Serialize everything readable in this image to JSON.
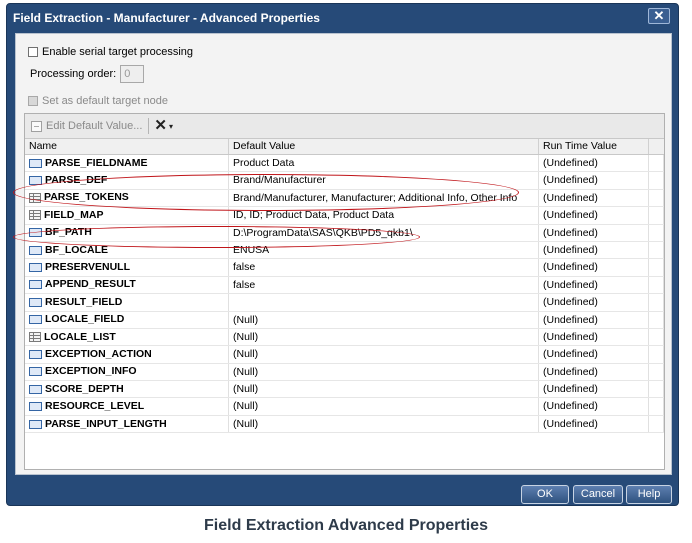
{
  "window": {
    "title": "Field Extraction - Manufacturer - Advanced Properties",
    "close_label": "✕"
  },
  "options": {
    "serial_label": "Enable serial target processing",
    "order_label": "Processing order:",
    "order_value": "0",
    "default_node_label": "Set as default target node"
  },
  "toolbar": {
    "edit_label": "Edit Default Value...",
    "delete_icon": "✕",
    "dropdown_icon": "▾"
  },
  "table": {
    "columns": [
      "Name",
      "Default Value",
      "Run Time Value"
    ],
    "rows": [
      {
        "icon": "abc",
        "name": "PARSE_FIELDNAME",
        "default": "Product Data",
        "runtime": "(Undefined)"
      },
      {
        "icon": "abc",
        "name": "PARSE_DEF",
        "default": "Brand/Manufacturer",
        "runtime": "(Undefined)"
      },
      {
        "icon": "list",
        "name": "PARSE_TOKENS",
        "default": "Brand/Manufacturer, Manufacturer; Additional Info, Other Info",
        "runtime": "(Undefined)"
      },
      {
        "icon": "list",
        "name": "FIELD_MAP",
        "default": "ID, ID; Product Data, Product Data",
        "runtime": "(Undefined)"
      },
      {
        "icon": "abc",
        "name": "BF_PATH",
        "default": "D:\\ProgramData\\SAS\\QKB\\PD5_qkb1\\",
        "runtime": "(Undefined)"
      },
      {
        "icon": "abc",
        "name": "BF_LOCALE",
        "default": "ENUSA",
        "runtime": "(Undefined)"
      },
      {
        "icon": "abc",
        "name": "PRESERVENULL",
        "default": "false",
        "runtime": "(Undefined)"
      },
      {
        "icon": "abc",
        "name": "APPEND_RESULT",
        "default": "false",
        "runtime": "(Undefined)"
      },
      {
        "icon": "abc",
        "name": "RESULT_FIELD",
        "default": "",
        "runtime": "(Undefined)"
      },
      {
        "icon": "abc",
        "name": "LOCALE_FIELD",
        "default": "(Null)",
        "runtime": "(Undefined)"
      },
      {
        "icon": "list",
        "name": "LOCALE_LIST",
        "default": "(Null)",
        "runtime": "(Undefined)"
      },
      {
        "icon": "abc",
        "name": "EXCEPTION_ACTION",
        "default": "(Null)",
        "runtime": "(Undefined)"
      },
      {
        "icon": "abc",
        "name": "EXCEPTION_INFO",
        "default": "(Null)",
        "runtime": "(Undefined)"
      },
      {
        "icon": "abc",
        "name": "SCORE_DEPTH",
        "default": "(Null)",
        "runtime": "(Undefined)"
      },
      {
        "icon": "abc",
        "name": "RESOURCE_LEVEL",
        "default": "(Null)",
        "runtime": "(Undefined)"
      },
      {
        "icon": "abc",
        "name": "PARSE_INPUT_LENGTH",
        "default": "(Null)",
        "runtime": "(Undefined)"
      }
    ]
  },
  "buttons": {
    "ok": "OK",
    "cancel": "Cancel",
    "help": "Help"
  },
  "caption": "Field Extraction Advanced Properties",
  "colors": {
    "frame": "#264a78",
    "annotation": "#c0151a"
  }
}
